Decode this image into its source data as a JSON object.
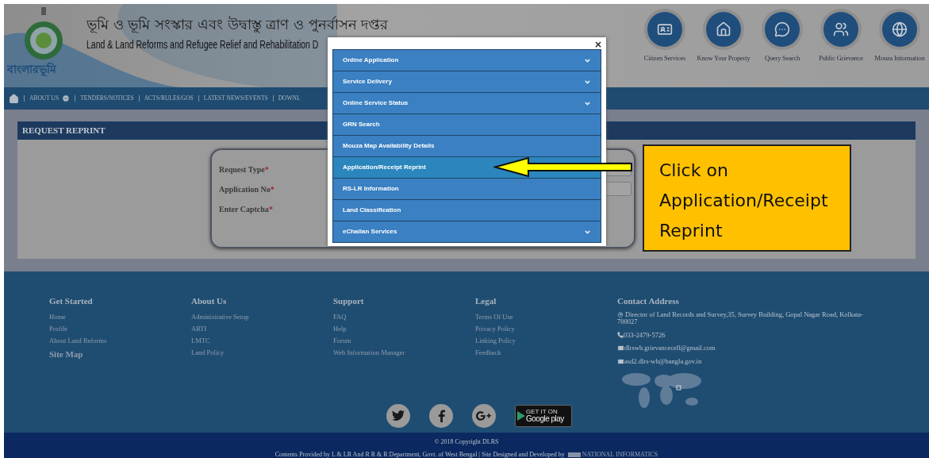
{
  "header": {
    "emblem_text": "বাংলারভূমি",
    "title_bn": "ভূমি ও ভূমি সংস্কার এবং উদ্বাস্তু ত্রাণ ও পুনর্বাসন দপ্তর",
    "title_en": "Land & Land Reforms and Refugee Relief and Rehabilitation D",
    "quick_links": [
      {
        "label": "Citizen Services",
        "kind": "card"
      },
      {
        "label": "Know Your Property",
        "kind": "house"
      },
      {
        "label": "Query Search",
        "kind": "chat"
      },
      {
        "label": "Public Grievance",
        "kind": "people"
      },
      {
        "label": "Mouza Information",
        "kind": "globe"
      }
    ]
  },
  "nav": [
    {
      "label": "ABOUT US",
      "dropdown": true
    },
    {
      "label": "TENDERS/NOTICES",
      "dropdown": false
    },
    {
      "label": "ACTS/RULES/GOS",
      "dropdown": false
    },
    {
      "label": "LATEST NEWS/EVENTS",
      "dropdown": false
    },
    {
      "label": "DOWNL",
      "dropdown": false
    }
  ],
  "panel": {
    "title": "REQUEST REPRINT",
    "fields": [
      {
        "label": "Request Type",
        "marker": "*"
      },
      {
        "label": "Application No",
        "marker": "*"
      },
      {
        "label": "Enter Captcha",
        "marker": "*"
      }
    ]
  },
  "modal": {
    "close": "×",
    "items": [
      {
        "label": "Online Application",
        "expandable": true,
        "selected": false
      },
      {
        "label": "Service Delivery",
        "expandable": true,
        "selected": false
      },
      {
        "label": "Online Service Status",
        "expandable": true,
        "selected": false
      },
      {
        "label": "GRN Search",
        "expandable": false,
        "selected": false
      },
      {
        "label": "Mouza Map Availability Details",
        "expandable": false,
        "selected": false
      },
      {
        "label": "Application/Receipt Reprint",
        "expandable": false,
        "selected": true
      },
      {
        "label": "RS-LR Information",
        "expandable": false,
        "selected": false
      },
      {
        "label": "Land Classification",
        "expandable": false,
        "selected": false
      },
      {
        "label": "eChallan Services",
        "expandable": true,
        "selected": false
      }
    ]
  },
  "callout": {
    "text": "Click on Application/Receipt Reprint"
  },
  "footer": {
    "columns": [
      {
        "heading": "Get Started",
        "links": [
          "Home",
          "Profile",
          "About Land Reforms"
        ],
        "subheading": "Site Map"
      },
      {
        "heading": "About Us",
        "links": [
          "Administrative Setup",
          "ARTI",
          "LMTC",
          "Land Policy"
        ]
      },
      {
        "heading": "Support",
        "links": [
          "FAQ",
          "Help",
          "Forum",
          "Web Information Manager"
        ]
      },
      {
        "heading": "Legal",
        "links": [
          "Terms Of Use",
          "Privacy Policy",
          "Linking Policy",
          "Feedback"
        ]
      }
    ],
    "contact": {
      "heading": "Contact Address",
      "address": "Director of Land Records and Survey,35, Survey Building, Gopal Nagar Road, Kolkata-700027",
      "phone": "033-2479-5726",
      "emails": [
        "dlrswb.grievancecell@gmail.com",
        "asd2.dlrs-wb@bangla.gov.in"
      ]
    },
    "google_play": {
      "small": "GET IT ON",
      "big": "Google play"
    }
  },
  "bottom": {
    "copyright": "© 2018 Copyright DLRS",
    "credits": "Contents Provided by L & LR And R R & R Department, Govt. of West Bengal | Site Designed and Developed by",
    "nic_text": "NATIONAL INFORMATICS"
  }
}
